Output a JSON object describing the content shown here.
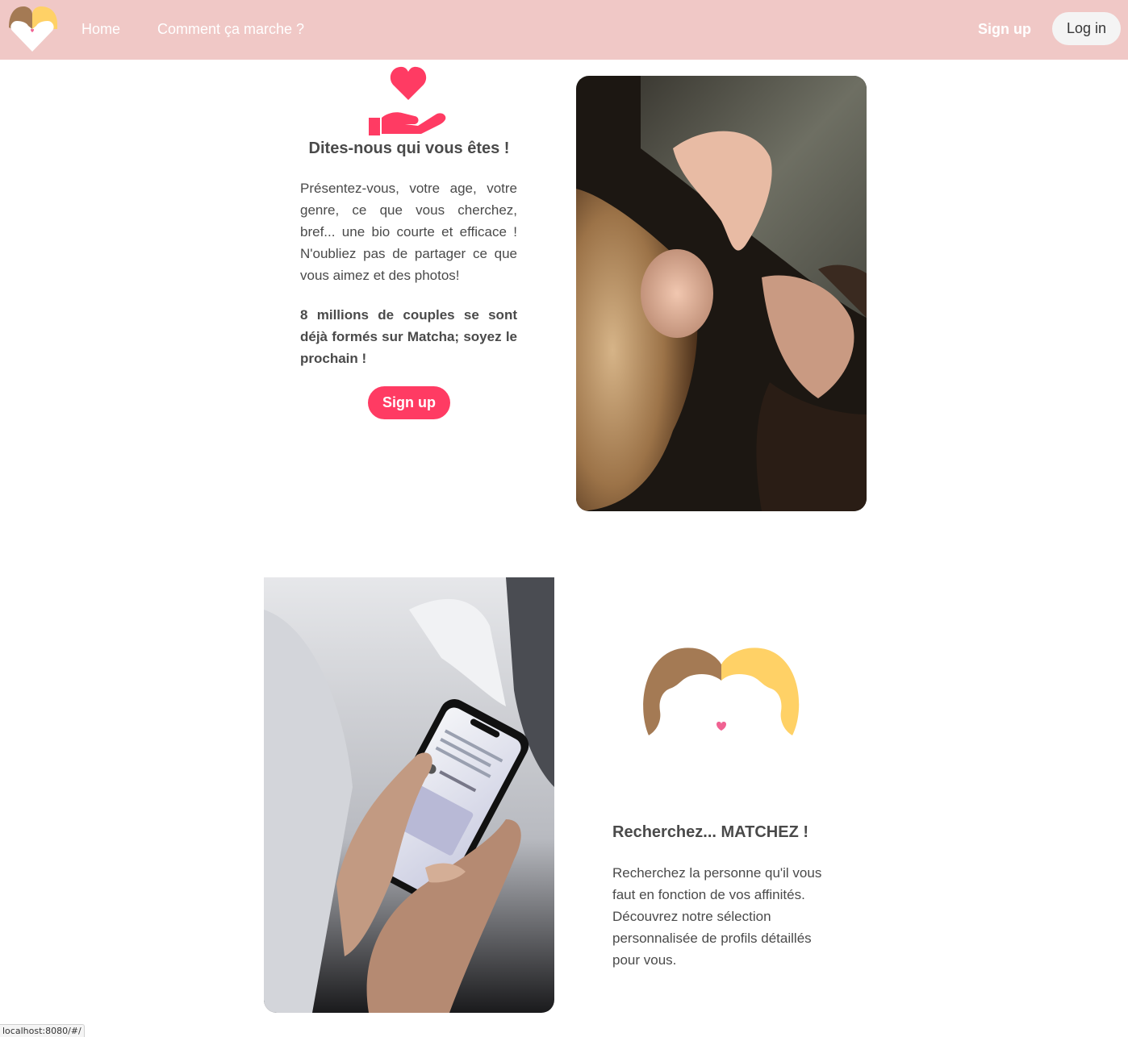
{
  "navbar": {
    "logo": "matcha-faces-heart-logo",
    "links": [
      {
        "label": "Home"
      },
      {
        "label": "Comment ça marche ?"
      }
    ],
    "signup_label": "Sign up",
    "login_label": "Log in",
    "colors": {
      "background": "#f0c8c6",
      "text": "#ffffff"
    }
  },
  "section_profile": {
    "icon": "heart-in-hand-icon",
    "title": "Dites-nous qui vous êtes !",
    "body": "Présentez-vous, votre age, votre genre, ce que vous cherchez, bref... une bio courte et efficace ! N'oubliez pas de partager ce que vous aimez et des photos!",
    "highlight": "8 millions de couples se sont déjà formés sur Matcha; soyez le prochain !",
    "cta_label": "Sign up",
    "image": "couple-embracing-photo"
  },
  "section_match": {
    "image": "hands-holding-smartphone-photo",
    "icon": "two-faces-heart-icon",
    "title": "Recherchez... MATCHEZ !",
    "body": "Recherchez la personne qu'il vous faut en fonction de vos affinités. Découvrez notre sélection personnalisée de profils détaillés pour vous."
  },
  "status_bar": {
    "url": "localhost:8080/#/"
  },
  "colors": {
    "accent": "#ff3b63",
    "brown_face": "#a47a54",
    "yellow_face": "#ffd166",
    "heart_pink": "#f06292"
  }
}
